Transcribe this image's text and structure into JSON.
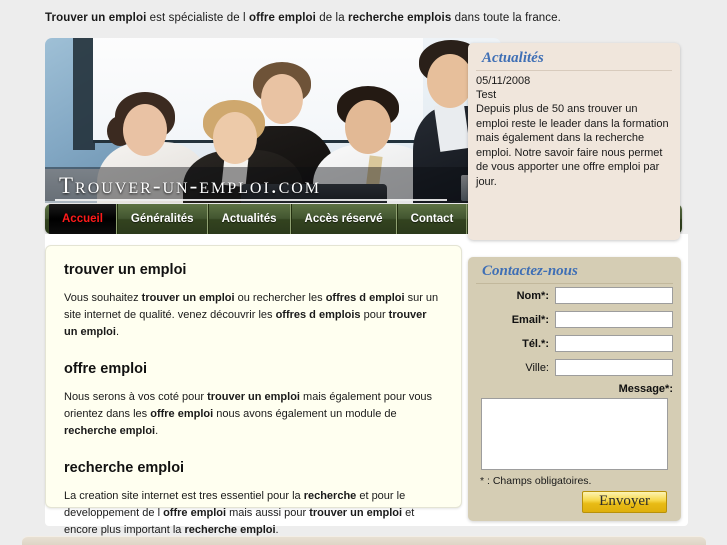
{
  "tagline": {
    "p1": "Trouver un emploi",
    "p2": " est spécialiste de l ",
    "p3": "offre emploi",
    "p4": " de la ",
    "p5": "recherche emplois",
    "p6": " dans toute la france."
  },
  "hero": {
    "logo": "Trouver-un-emploi.com"
  },
  "nav": {
    "items": [
      {
        "label": "Accueil",
        "active": true
      },
      {
        "label": "Généralités",
        "active": false
      },
      {
        "label": "Actualités",
        "active": false
      },
      {
        "label": "Accès réservé",
        "active": false
      },
      {
        "label": "Contact",
        "active": false
      }
    ]
  },
  "actualites": {
    "title": "Actualités",
    "date": "05/11/2008",
    "news_title": "Test",
    "body": "Depuis plus de 50 ans trouver un emploi reste le leader dans la formation mais également dans la recherche emploi. Notre savoir faire nous permet de vous apporter une offre emploi par jour."
  },
  "content": {
    "section1": {
      "heading": "trouver un emploi",
      "t1": "Vous souhaitez ",
      "b1": "trouver un emploi",
      "t2": " ou rechercher les ",
      "b2": "offres d emploi",
      "t3": " sur un site internet de qualité. venez découvrir les ",
      "b3": "offres d emplois",
      "t4": " pour ",
      "b4": "trouver un emploi",
      "t5": "."
    },
    "section2": {
      "heading": "offre emploi",
      "t1": "Nous serons à vos coté pour ",
      "b1": "trouver un emploi",
      "t2": " mais également pour vous orientez dans les ",
      "b2": "offre emploi",
      "t3": " nous avons également un module de ",
      "b3": "recherche emploi",
      "t4": "."
    },
    "section3": {
      "heading": "recherche emploi",
      "t1": "La creation site internet est tres essentiel pour la ",
      "b1": "recherche",
      "t2": " et pour le developpement de l ",
      "b2": "offre emploi",
      "t3": " mais aussi pour ",
      "b3": "trouver un emploi",
      "t4": " et encore plus important la ",
      "b4": "recherche emploi",
      "t5": "."
    }
  },
  "contact": {
    "title": "Contactez-nous",
    "fields": [
      {
        "label": "Nom*:",
        "value": "",
        "placeholder": "",
        "required": true
      },
      {
        "label": "Email*:",
        "value": "",
        "placeholder": "",
        "required": true
      },
      {
        "label": "Tél.*:",
        "value": "",
        "placeholder": "",
        "required": true
      },
      {
        "label": "Ville:",
        "value": "",
        "placeholder": "",
        "required": false
      }
    ],
    "message_label": "Message*:",
    "message_value": "",
    "message_placeholder": "",
    "required_note": "* : Champs obligatoires.",
    "submit_label": "Envoyer"
  },
  "colors": {
    "page_background": "#ededed",
    "nav_green": "#425530",
    "active_tab_text": "#ff1a1a",
    "panel_title_blue": "#3f6fb5",
    "actualites_panel": "#f0e6dc",
    "contact_panel": "#d5cdb4",
    "content_box": "#fffff0",
    "submit_gold": "#f7d84a"
  }
}
